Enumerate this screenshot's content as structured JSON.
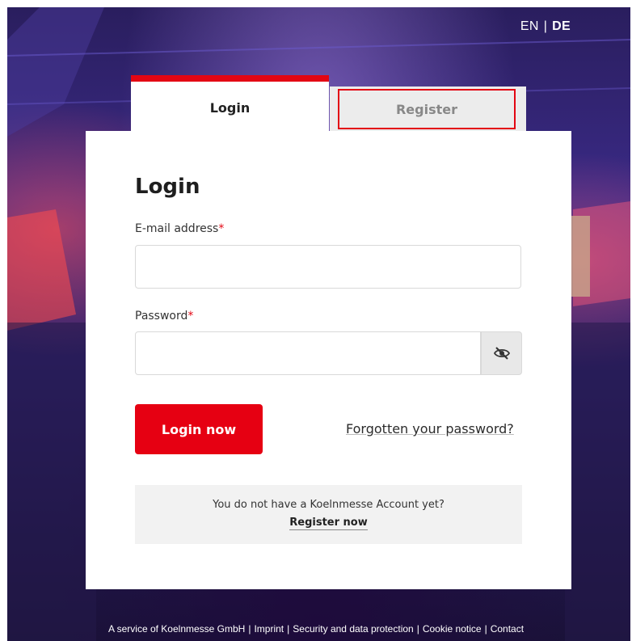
{
  "language": {
    "en": "EN",
    "separator": "|",
    "de": "DE"
  },
  "tabs": {
    "login": "Login",
    "register": "Register"
  },
  "form": {
    "heading": "Login",
    "email_label": "E-mail address",
    "required_marker": "*",
    "email_value": "",
    "password_label": "Password",
    "password_value": "",
    "visibility_icon": "eye-slash-icon",
    "submit_label": "Login now",
    "forgot_label": "Forgotten your password?"
  },
  "register_prompt": {
    "text": "You do not have a Koelnmesse Account yet?",
    "link": "Register now"
  },
  "footer": {
    "service": "A service of Koelnmesse GmbH",
    "imprint": "Imprint",
    "privacy": "Security and data protection",
    "cookie": "Cookie notice",
    "contact": "Contact",
    "separator": "|"
  },
  "colors": {
    "accent": "#e30613",
    "button": "#e60012",
    "annotation": "#e30613"
  }
}
